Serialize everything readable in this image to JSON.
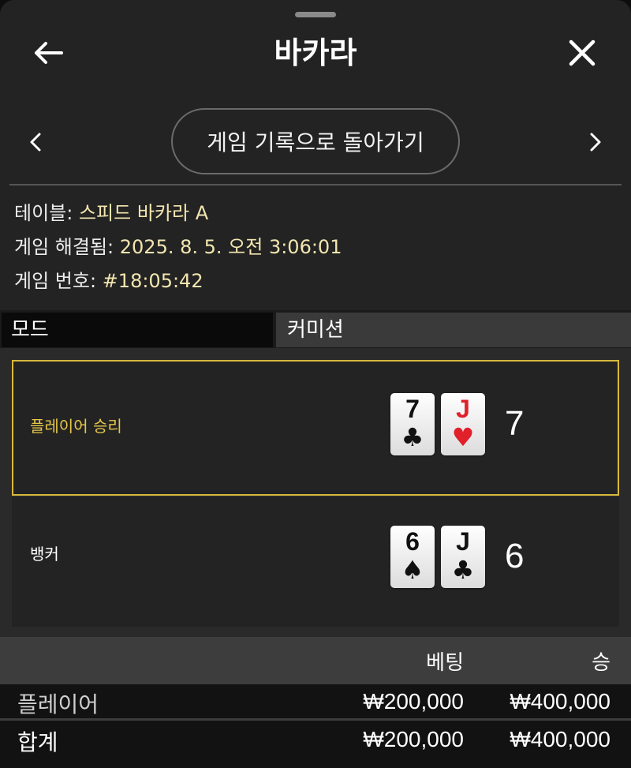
{
  "header": {
    "title": "바카라",
    "back_icon": "arrow-left-icon",
    "close_icon": "close-icon"
  },
  "nav": {
    "back_to_history": "게임 기록으로 돌아가기",
    "prev_icon": "chevron-left-icon",
    "next_icon": "chevron-right-icon"
  },
  "info": {
    "table_label": "테이블:",
    "table_value": "스피드 바카라 A",
    "resolved_label": "게임 해결됨:",
    "resolved_value": "2025. 8. 5. 오전 3:06:01",
    "game_no_label": "게임 번호:",
    "game_no_value": "#18:05:42"
  },
  "mode": {
    "label": "모드",
    "value": "커미션"
  },
  "results": {
    "player": {
      "label": "플레이어 승리",
      "score": "7",
      "cards": [
        {
          "rank": "7",
          "suit": "♣",
          "color": "#111111"
        },
        {
          "rank": "J",
          "suit": "♥",
          "color": "#e0202a"
        }
      ]
    },
    "banker": {
      "label": "뱅커",
      "score": "6",
      "cards": [
        {
          "rank": "6",
          "suit": "♠",
          "color": "#111111"
        },
        {
          "rank": "J",
          "suit": "♣",
          "color": "#111111"
        }
      ]
    },
    "win_highlight_color": "#d8b93d"
  },
  "bets": {
    "columns": {
      "bet": "베팅",
      "win": "승"
    },
    "rows": [
      {
        "label": "플레이어",
        "bet": "₩200,000",
        "win": "₩400,000"
      }
    ],
    "total": {
      "label": "합계",
      "bet": "₩200,000",
      "win": "₩400,000"
    }
  }
}
